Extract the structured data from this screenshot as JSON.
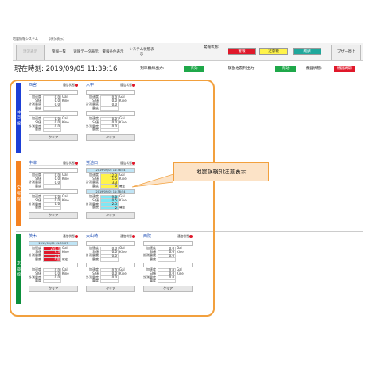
{
  "window": {
    "title": "地震情報システム",
    "tab": "【現況表示】"
  },
  "toolbar": {
    "buttons": [
      "現況表示",
      "警報一覧",
      "速報データ表示",
      "警報条件表示",
      "システム状態表示"
    ],
    "active_index": 0,
    "buzzer_label": "ブザー停止"
  },
  "alerts": {
    "label": "発報状態:",
    "chips": [
      {
        "label": "警報",
        "color": "#e0182a"
      },
      {
        "label": "注意報",
        "color": "#fff34a"
      },
      {
        "label": "離調",
        "color": "#1fa89c"
      }
    ]
  },
  "status": {
    "clock": "現在時刻:  2019/09/05 11:39:16",
    "items": [
      {
        "label": "列車無線出力:",
        "value": "有効",
        "color": "#1fa84a"
      },
      {
        "label": "緊急地震列出力:",
        "value": "有効",
        "color": "#1fa84a"
      },
      {
        "label": "機器状態:",
        "value": "機器異常",
        "color": "#e0182a"
      }
    ]
  },
  "common": {
    "comm_label": "通信状態",
    "clear_label": "クリア",
    "row_labels": [
      "加速度",
      "SI値",
      "計測震度",
      "震度"
    ],
    "units": [
      "Gal",
      "Kine",
      "",
      ""
    ],
    "confirm_label": "確定"
  },
  "lines": [
    {
      "name": "神戸線",
      "color": "#1d3fd6",
      "stations": [
        {
          "name": "西宮",
          "groups": [
            {
              "timestamp": "",
              "ts_style": "empty",
              "values": [
                "0.0",
                "0.0",
                "0.0",
                ""
              ],
              "styles": [
                "",
                "",
                "",
                ""
              ],
              "confirmed": false
            },
            {
              "timestamp": "",
              "ts_style": "empty",
              "values": [
                "0.0",
                "0.0",
                "0.0",
                ""
              ],
              "styles": [
                "",
                "",
                "",
                ""
              ],
              "confirmed": false
            }
          ]
        },
        {
          "name": "六甲",
          "groups": [
            {
              "timestamp": "",
              "ts_style": "empty",
              "values": [
                "0.0",
                "0.0",
                "0.0",
                ""
              ],
              "styles": [
                "",
                "",
                "",
                ""
              ],
              "confirmed": false
            },
            {
              "timestamp": "",
              "ts_style": "empty",
              "values": [
                "0.0",
                "0.0",
                "0.0",
                ""
              ],
              "styles": [
                "",
                "",
                "",
                ""
              ],
              "confirmed": false
            }
          ]
        }
      ]
    },
    {
      "name": "宝塚線",
      "color": "#f58220",
      "stations": [
        {
          "name": "中津",
          "groups": [
            {
              "timestamp": "",
              "ts_style": "empty",
              "values": [
                "0.0",
                "0.0",
                "0.0",
                ""
              ],
              "styles": [
                "",
                "",
                "",
                ""
              ],
              "confirmed": false
            },
            {
              "timestamp": "",
              "ts_style": "empty",
              "values": [
                "0.0",
                "0.0",
                "0.0",
                ""
              ],
              "styles": [
                "",
                "",
                "",
                ""
              ],
              "confirmed": false
            }
          ]
        },
        {
          "name": "蛍池口",
          "groups": [
            {
              "timestamp": "2019/09/05 11:38:54",
              "ts_style": "blue",
              "values": [
                "12.3",
                "1.5",
                "3.3",
                "3"
              ],
              "styles": [
                "yellow",
                "yellow",
                "yellow",
                "yellow"
              ],
              "confirmed": true
            },
            {
              "timestamp": "2019/09/05 11:38:54",
              "ts_style": "blue",
              "values": [
                "9.8",
                "0.5",
                "2.3",
                "2"
              ],
              "styles": [
                "cyan",
                "cyan",
                "cyan",
                "cyan"
              ],
              "confirmed": true
            }
          ]
        }
      ]
    },
    {
      "name": "京都線",
      "color": "#0c8f3c",
      "stations": [
        {
          "name": "茨木",
          "groups": [
            {
              "timestamp": "2019/09/05 11:39:07",
              "ts_style": "blue",
              "values": [
                "280.4",
                "9.3",
                "5.1",
                "5強"
              ],
              "styles": [
                "red",
                "red",
                "red",
                "red"
              ],
              "confirmed": true
            },
            {
              "timestamp": "",
              "ts_style": "empty",
              "values": [
                "0.0",
                "0.0",
                "0.0",
                ""
              ],
              "styles": [
                "",
                "",
                "",
                ""
              ],
              "confirmed": false
            }
          ]
        },
        {
          "name": "大山崎",
          "groups": [
            {
              "timestamp": "",
              "ts_style": "empty",
              "values": [
                "0.0",
                "0.0",
                "0.0",
                ""
              ],
              "styles": [
                "",
                "",
                "",
                ""
              ],
              "confirmed": false
            },
            {
              "timestamp": "",
              "ts_style": "empty",
              "values": [
                "0.0",
                "0.0",
                "0.0",
                ""
              ],
              "styles": [
                "",
                "",
                "",
                ""
              ],
              "confirmed": false
            }
          ]
        },
        {
          "name": "西院",
          "groups": [
            {
              "timestamp": "",
              "ts_style": "empty",
              "values": [
                "0.0",
                "0.0",
                "0.0",
                ""
              ],
              "styles": [
                "",
                "",
                "",
                ""
              ],
              "confirmed": false
            },
            {
              "timestamp": "",
              "ts_style": "empty",
              "values": [
                "0.0",
                "0.0",
                "0.0",
                ""
              ],
              "styles": [
                "",
                "",
                "",
                ""
              ],
              "confirmed": false
            }
          ]
        }
      ]
    }
  ],
  "callout": {
    "text": "地震誤検知注意表示"
  }
}
